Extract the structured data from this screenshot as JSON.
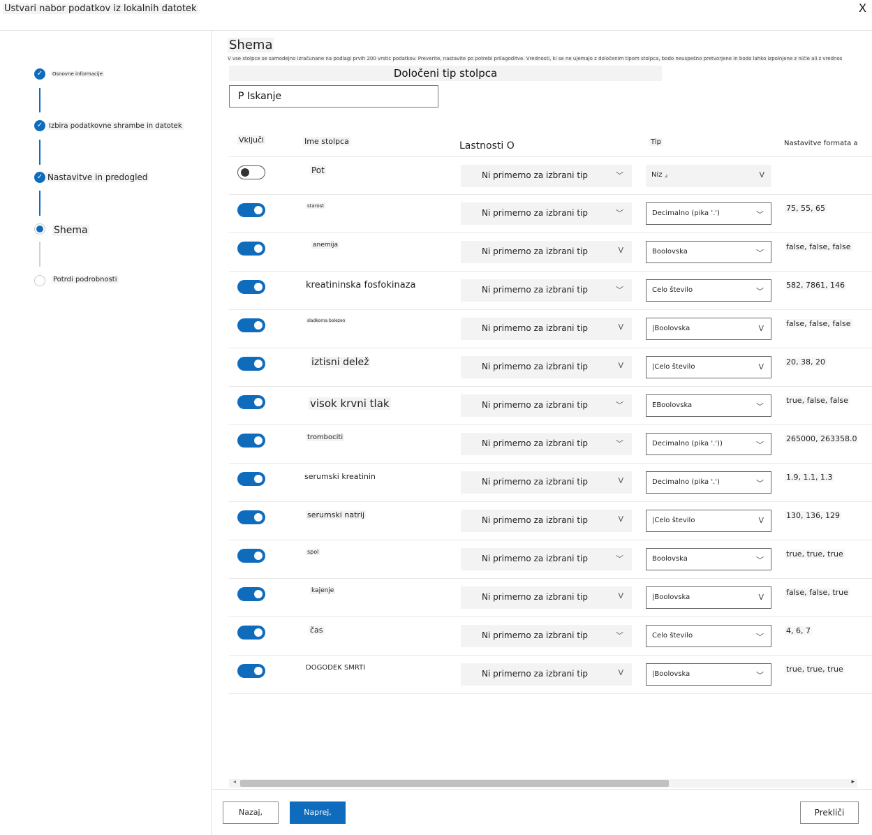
{
  "header": {
    "title": "Ustvari nabor podatkov iz lokalnih datotek",
    "close_label": "X"
  },
  "sidebar": {
    "steps": [
      {
        "label": "Osnovne informacije",
        "state": "done"
      },
      {
        "label": "Izbira podatkovne shrambe in datotek",
        "state": "done"
      },
      {
        "label": "Nastavitve in predogled",
        "state": "done"
      },
      {
        "label": "Shema",
        "state": "current"
      },
      {
        "label": "Potrdi podrobnosti",
        "state": "todo"
      }
    ]
  },
  "main": {
    "title": "Shema",
    "description": "V vse stolpce se samodejno izračunane na podlagi prvih 200 vrstic podatkov. Preverite, nastavite po potrebi prilagoditve. Vrednosti, ki se ne ujemajo z določenim tipom stolpca, bodo neuspešno pretvorjene in bodo lahko izpolnjene z ničle ali z vrednostmi z vrednostjo napaka.",
    "detected_button": "Določeni tip stolpca",
    "search_placeholder": "P Iskanje",
    "columns": {
      "include": "Vključi",
      "name": "Ime stolpca",
      "properties": "Lastnosti O",
      "type": "Tip",
      "format": "Nastavitve formata a"
    },
    "rows": [
      {
        "on": false,
        "name": "Pot",
        "props": "Ni primerno za izbrani tip",
        "props_chev": "﹀",
        "type": "Niz ⌟",
        "type_chev": "V",
        "format": ""
      },
      {
        "on": true,
        "name": "starost",
        "props": "Ni primerno za izbrani tip",
        "props_chev": "﹀",
        "type": "Decimalno (pika '.')",
        "type_chev": "﹀",
        "format": "75, 55, 65"
      },
      {
        "on": true,
        "name": "anemija",
        "props": "Ni primerno za izbrani tip",
        "props_chev": "V",
        "type": "Boolovska",
        "type_chev": "﹀",
        "format": "false, false, false"
      },
      {
        "on": true,
        "name": "kreatininska fosfokinaza",
        "props": "Ni primerno za izbrani tip",
        "props_chev": "﹀",
        "type": "Celo število",
        "type_chev": "﹀",
        "format": "582, 7861, 146"
      },
      {
        "on": true,
        "name": "sladkorna bolezen",
        "props": "Ni primerno za izbrani tip",
        "props_chev": "V",
        "type": "|Boolovska",
        "type_chev": "V",
        "format": "false, false, false"
      },
      {
        "on": true,
        "name": "iztisni delež",
        "props": "Ni primerno za izbrani tip",
        "props_chev": "V",
        "type": "|Celo število",
        "type_chev": "V",
        "format": "20, 38, 20"
      },
      {
        "on": true,
        "name": "visok krvni tlak",
        "props": "Ni primerno za izbrani tip",
        "props_chev": "﹀",
        "type": "EBoolovska",
        "type_chev": "﹀",
        "format": "true, false, false"
      },
      {
        "on": true,
        "name": "trombociti",
        "props": "Ni primerno za izbrani tip",
        "props_chev": "﹀",
        "type": "Decimalno (pika '.'))",
        "type_chev": "﹀",
        "format": "265000, 263358.0"
      },
      {
        "on": true,
        "name": "serumski kreatinin",
        "props": "Ni primerno za izbrani tip",
        "props_chev": "V",
        "type": "Decimalno (pika '.')",
        "type_chev": "﹀",
        "format": "1.9, 1.1, 1.3"
      },
      {
        "on": true,
        "name": "serumski natrij",
        "props": "Ni primerno za izbrani tip",
        "props_chev": "V",
        "type": "|Celo število",
        "type_chev": "V",
        "format": "130, 136, 129"
      },
      {
        "on": true,
        "name": "spol",
        "props": "Ni primerno za izbrani tip",
        "props_chev": "﹀",
        "type": "Boolovska",
        "type_chev": "﹀",
        "format": "true, true, true"
      },
      {
        "on": true,
        "name": "kajenje",
        "props": "Ni primerno za izbrani tip",
        "props_chev": "V",
        "type": "|Boolovska",
        "type_chev": "V",
        "format": "false, false, true"
      },
      {
        "on": true,
        "name": "čas",
        "props": "Ni primerno za izbrani tip",
        "props_chev": "﹀",
        "type": "Celo število",
        "type_chev": "﹀",
        "format": "4, 6, 7"
      },
      {
        "on": true,
        "name": "DOGODEK SMRTI",
        "props": "Ni primerno za izbrani tip",
        "props_chev": "V",
        "type": "|Boolovska",
        "type_chev": "﹀",
        "format": "true, true, true"
      }
    ]
  },
  "footer": {
    "back": "Nazaj,",
    "next": "Naprej,",
    "cancel": "Prekliči"
  },
  "colors": {
    "accent": "#0f6cbd",
    "label_bg": "#f3f3f3"
  }
}
